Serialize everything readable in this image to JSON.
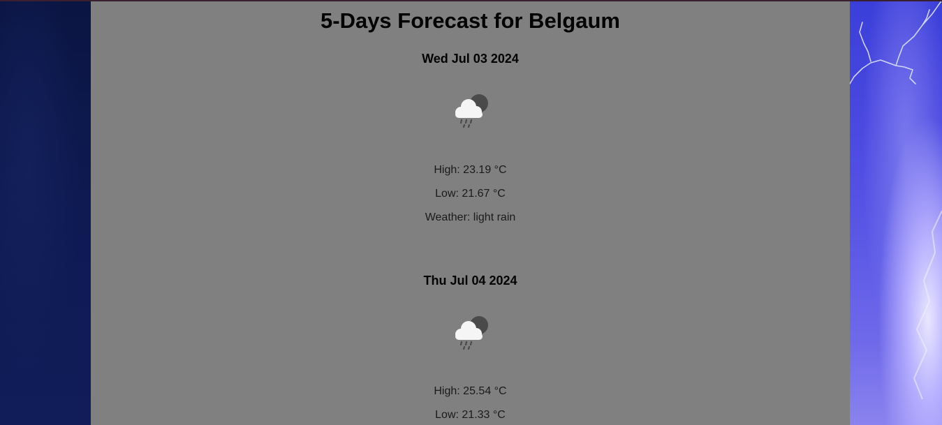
{
  "page": {
    "title": "5-Days Forecast for Belgaum"
  },
  "forecast": [
    {
      "date": "Wed Jul 03 2024",
      "icon": "rain-cloud-moon-icon",
      "high": "High: 23.19 °C",
      "low": "Low: 21.67 °C",
      "weather": "Weather: light rain"
    },
    {
      "date": "Thu Jul 04 2024",
      "icon": "rain-cloud-moon-icon",
      "high": "High: 25.54 °C",
      "low": "Low: 21.33 °C"
    }
  ],
  "colors": {
    "panel": "#808080",
    "background_left": "#0d1848",
    "background_right": "#4a49e0",
    "text": "#000000"
  }
}
